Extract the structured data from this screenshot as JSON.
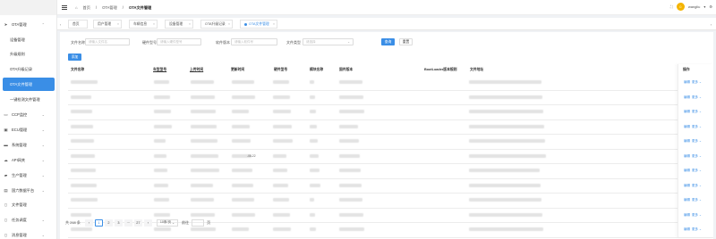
{
  "sidebar": {
    "items": [
      {
        "label": "OTA管理",
        "icon": "send-icon",
        "expanded": true
      },
      {
        "label": "CCP监控",
        "icon": "monitor-icon"
      },
      {
        "label": "ECU管理",
        "icon": "ecu-icon"
      },
      {
        "label": "系统管理",
        "icon": "folder-icon"
      },
      {
        "label": "API网关",
        "icon": "cloud-icon"
      },
      {
        "label": "生产管理",
        "icon": "truck-icon"
      },
      {
        "label": "国六数据平台",
        "icon": "chart-icon"
      },
      {
        "label": "文件管理",
        "icon": "file-icon"
      },
      {
        "label": "任务调度",
        "icon": "task-icon"
      },
      {
        "label": "消息管理",
        "icon": "message-icon"
      }
    ],
    "subitems": [
      {
        "label": "设备管理"
      },
      {
        "label": "升级规则"
      },
      {
        "label": "OTA升级记录"
      },
      {
        "label": "OTA文件管理",
        "active": true
      },
      {
        "label": "一键检测文件管理"
      }
    ]
  },
  "topbar": {
    "breadcrumbs": [
      "首页",
      "OTA管理",
      "OTA文件管理"
    ],
    "username": "wangliu"
  },
  "tabs": [
    {
      "label": "首页"
    },
    {
      "label": "用户管理"
    },
    {
      "label": "车辆信息"
    },
    {
      "label": "设备管理"
    },
    {
      "label": "OTA升级记录"
    },
    {
      "label": "OTA文件管理",
      "active": true
    }
  ],
  "filters": {
    "file_name": {
      "label": "文件名称",
      "placeholder": "请输入文件名"
    },
    "hardware_version": {
      "label": "硬件型号",
      "placeholder": "请输入硬件型号"
    },
    "software_version": {
      "label": "软件版本",
      "placeholder": "请输入软件号"
    },
    "file_type": {
      "label": "文件类型",
      "placeholder": "请选择"
    },
    "search_label": "查询",
    "reset_label": "重置",
    "add_label": "添加"
  },
  "table": {
    "columns": [
      "文件名称",
      "车型型号",
      "上传时间",
      "更新时间",
      "硬件型号",
      "模块名称",
      "固件版本",
      "BootLoader版本规则",
      "文件地址",
      "操作"
    ],
    "rows": [
      {
        "col2": "",
        "col4": "",
        "op_edit": "编辑",
        "op_more": "更多"
      },
      {
        "col2": "",
        "col4": "",
        "op_edit": "编辑",
        "op_more": "更多"
      },
      {
        "col2": "",
        "col4": "",
        "op_edit": "编辑",
        "op_more": "更多"
      },
      {
        "col2": "",
        "col4": "",
        "op_edit": "编辑",
        "op_more": "更多"
      },
      {
        "col2": "",
        "col4": "",
        "op_edit": "编辑",
        "op_more": "更多"
      },
      {
        "col2": "",
        "col4": "-06-22",
        "op_edit": "编辑",
        "op_more": "更多"
      },
      {
        "col2": "",
        "col4": "",
        "op_edit": "编辑",
        "op_more": "更多"
      },
      {
        "col2": "",
        "col4": "",
        "op_edit": "编辑",
        "op_more": "更多"
      },
      {
        "col2": "",
        "col4": "",
        "op_edit": "编辑",
        "op_more": "更多"
      },
      {
        "col2": "",
        "col4": "",
        "op_edit": "编辑",
        "op_more": "更多"
      },
      {
        "col2": "",
        "col4": "",
        "op_edit": "编辑",
        "op_more": "更多"
      }
    ]
  },
  "pagination": {
    "total": "共 268 条",
    "pages": [
      "1",
      "2",
      "3",
      "···",
      "27"
    ],
    "page_size": "10条/页",
    "goto_label": "前往",
    "page_suffix": "页"
  }
}
